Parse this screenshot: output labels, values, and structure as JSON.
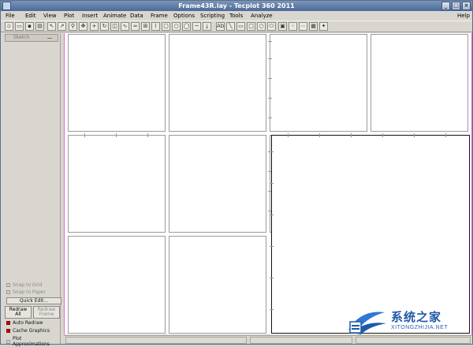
{
  "window": {
    "title": "Frame43R.lay - Tecplot 360 2011"
  },
  "menubar": [
    {
      "label": "File"
    },
    {
      "label": "Edit"
    },
    {
      "label": "View"
    },
    {
      "label": "Plot"
    },
    {
      "label": "Insert"
    },
    {
      "label": "Animate"
    },
    {
      "label": "Data"
    },
    {
      "label": "Frame"
    },
    {
      "label": "Options"
    },
    {
      "label": "Scripting"
    },
    {
      "label": "Tools"
    },
    {
      "label": "Analyze"
    }
  ],
  "help_label": "Help",
  "sidebar": {
    "mode_dropdown": "Sketch",
    "snap_to_grid": "Snap to Grid",
    "snap_to_paper": "Snap to Paper",
    "quick_edit": "Quick Edit...",
    "redraw_all_line1": "Redraw",
    "redraw_all_line2": "All",
    "redraw_frame_line1": "Redraw",
    "redraw_frame_line2": "Frame",
    "auto_redraw": "Auto Redraw",
    "cache_graphics": "Cache Graphics",
    "plot_approximations": "Plot Approximations"
  },
  "watermark": {
    "main": "系统之家",
    "sub": "XITONGZHIJIA.NET"
  },
  "colors": {
    "active_frame": "#111111",
    "paper_edge": "#e065d8",
    "check_on": "#d20000"
  }
}
